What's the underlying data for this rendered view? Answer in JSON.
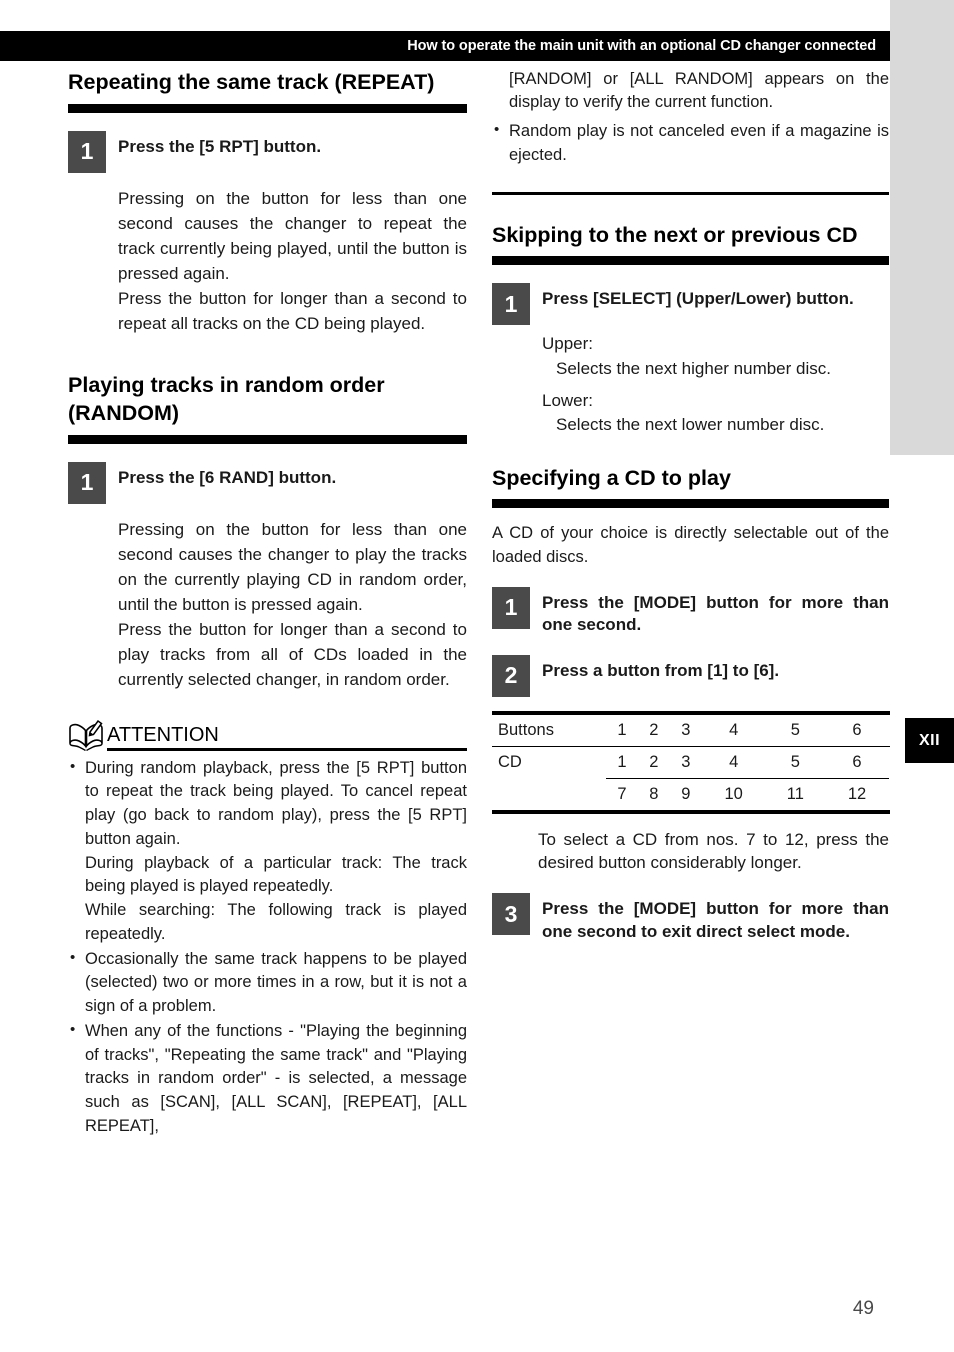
{
  "header": {
    "title": "How to operate the main unit with an optional CD changer connected"
  },
  "chapter_tab": {
    "label": "XII"
  },
  "page_number": "49",
  "left_column": {
    "section_repeat": {
      "title": "Repeating the same track (REPEAT)",
      "step1": {
        "number": "1",
        "title": "Press the [5 RPT] button.",
        "paragraphs": [
          "Pressing on the button for less than one second causes the changer to repeat the track currently being played, until the button is pressed again.",
          "Press the button for longer than a second to repeat all tracks on the CD being played."
        ]
      }
    },
    "section_random": {
      "title": "Playing tracks in random order (RANDOM)",
      "step1": {
        "number": "1",
        "title": "Press the [6 RAND] button.",
        "paragraphs": [
          "Pressing on the button for less than one second causes the changer to play the tracks on the currently playing CD in random order, until the button is pressed again.",
          "Press the button for longer than a second to play tracks from all of CDs loaded in the currently selected changer, in random order."
        ]
      }
    },
    "attention": {
      "label": "ATTENTION",
      "icon": "book-pencil-icon",
      "bullets": [
        [
          "During random playback, press the [5 RPT] button to repeat the track being played. To cancel repeat play (go back to random play), press the [5 RPT] button again.",
          "During playback of a particular track: The track being played is played repeatedly.",
          "While searching: The following track is played repeatedly."
        ],
        [
          "Occasionally the same track happens to be played (selected) two or more times in a row, but it is not a sign of a problem."
        ],
        [
          "When any of the functions - \"Playing the beginning of tracks\", \"Repeating the same track\" and \"Playing tracks in random order\" - is selected, a message such as [SCAN], [ALL SCAN], [REPEAT], [ALL REPEAT],"
        ]
      ]
    }
  },
  "right_column": {
    "continuation": {
      "paragraph": "[RANDOM] or [ALL RANDOM] appears on the display to verify the current function.",
      "bullets": [
        "Random play is not canceled even if a magazine is ejected."
      ]
    },
    "section_skipping": {
      "title": "Skipping to the next or previous CD",
      "step1": {
        "number": "1",
        "title": "Press [SELECT] (Upper/Lower) button.",
        "upper_label": "Upper:",
        "upper_detail": "Selects the next higher number disc.",
        "lower_label": "Lower:",
        "lower_detail": "Selects the next lower number disc."
      }
    },
    "section_specifying": {
      "title": "Specifying a CD to play",
      "intro": "A CD of your choice is directly selectable out of the loaded discs.",
      "step1": {
        "number": "1",
        "title": "Press the [MODE] button for more than one second."
      },
      "step2": {
        "number": "2",
        "title": "Press a button from [1] to [6]."
      },
      "table": {
        "row_buttons_label": "Buttons",
        "row_buttons_values": [
          "1",
          "2",
          "3",
          "4",
          "5",
          "6"
        ],
        "row_cd_label": "CD",
        "row_cd_values_1": [
          "1",
          "2",
          "3",
          "4",
          "5",
          "6"
        ],
        "row_cd_values_2": [
          "7",
          "8",
          "9",
          "10",
          "11",
          "12"
        ]
      },
      "note": "To select a CD from nos. 7 to 12, press the desired button considerably longer.",
      "step3": {
        "number": "3",
        "title": "Press the [MODE] button for more than one second to exit direct select mode."
      }
    }
  }
}
